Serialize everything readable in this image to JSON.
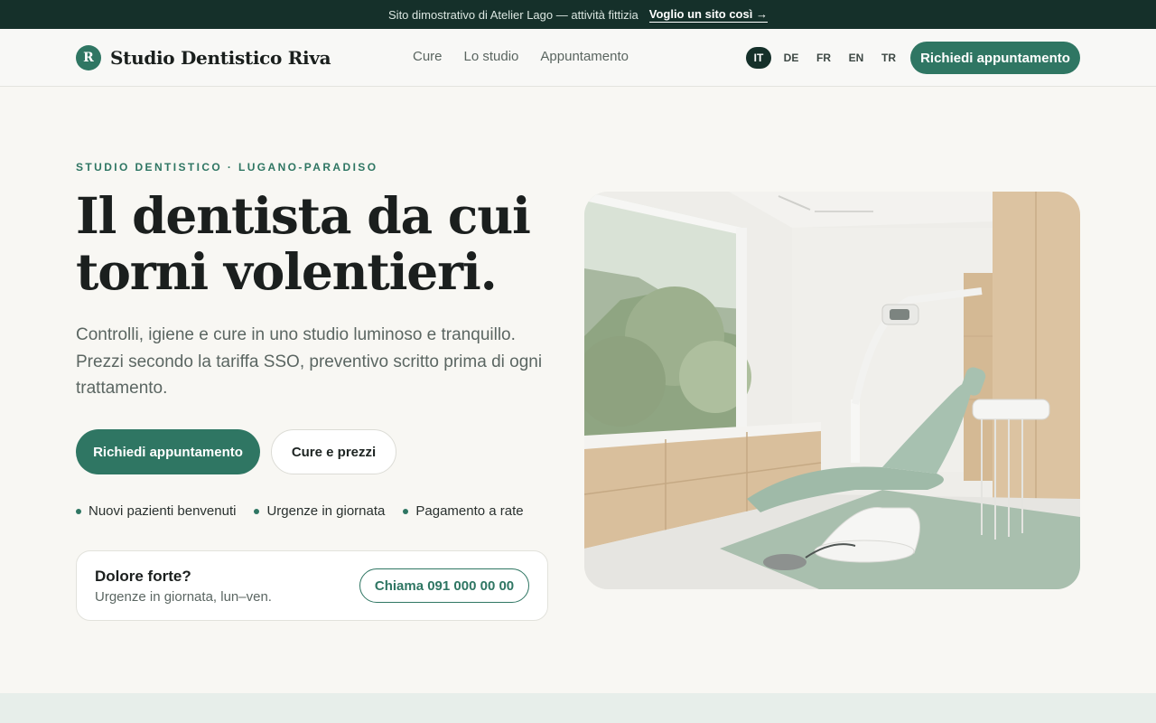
{
  "announcement": {
    "text": "Sito dimostrativo di Atelier Lago — attività fittizia",
    "link_label": "Voglio un sito così →"
  },
  "header": {
    "logo_letter": "R",
    "logo_name": "Studio Dentistico Riva",
    "nav": [
      "Cure",
      "Lo studio",
      "Appuntamento"
    ],
    "languages": [
      "IT",
      "DE",
      "FR",
      "EN",
      "TR"
    ],
    "active_language": "IT",
    "cta_label": "Richiedi appuntamento"
  },
  "hero": {
    "eyebrow": "STUDIO DENTISTICO · LUGANO-PARADISO",
    "headline": "Il dentista da cui torni volentieri.",
    "lead": "Controlli, igiene e cure in uno studio luminoso e tranquillo. Prezzi secondo la tariffa SSO, preventivo scritto prima di ogni trattamento.",
    "primary_button": "Richiedi appuntamento",
    "secondary_button": "Cure e prezzi",
    "perks": [
      "Nuovi pazienti benvenuti",
      "Urgenze in giornata",
      "Pagamento a rate"
    ],
    "urgent_card": {
      "title": "Dolore forte?",
      "subtitle": "Urgenze in giornata, lun–ven.",
      "call_label": "Chiama 091 000 00 00"
    }
  },
  "colors": {
    "brand": "#2f7663",
    "dark": "#15302a",
    "background": "#f8f7f3"
  }
}
